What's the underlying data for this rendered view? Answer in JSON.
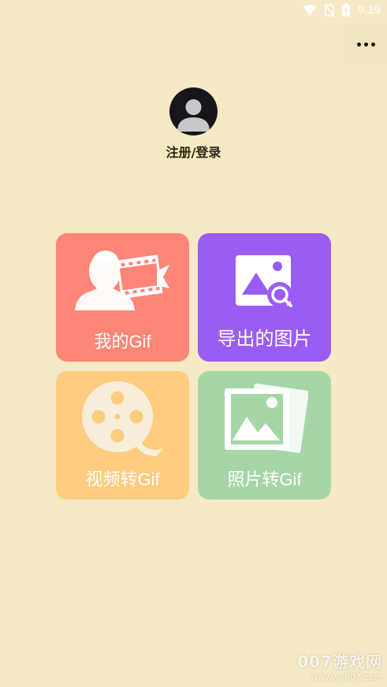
{
  "status_bar": {
    "time": "9:19",
    "icons": [
      "wifi-icon",
      "no-sim-icon",
      "battery-icon"
    ]
  },
  "menu": {
    "icon": "more-dots-icon"
  },
  "profile": {
    "login_label": "注册/登录",
    "avatar_icon": "user-avatar-icon"
  },
  "tiles": [
    {
      "label": "我的Gif",
      "icon": "person-film-icon",
      "color": "#fd8677"
    },
    {
      "label": "导出的图片",
      "icon": "image-search-icon",
      "color": "#9b5cf3"
    },
    {
      "label": "视频转Gif",
      "icon": "film-reel-icon",
      "color": "#fecb7f"
    },
    {
      "label": "照片转Gif",
      "icon": "photo-stack-icon",
      "color": "#a6d6a7"
    }
  ],
  "watermark": {
    "main": "007游戏网",
    "url": "www.yx007.com"
  },
  "colors": {
    "background": "#f6e9c5"
  }
}
